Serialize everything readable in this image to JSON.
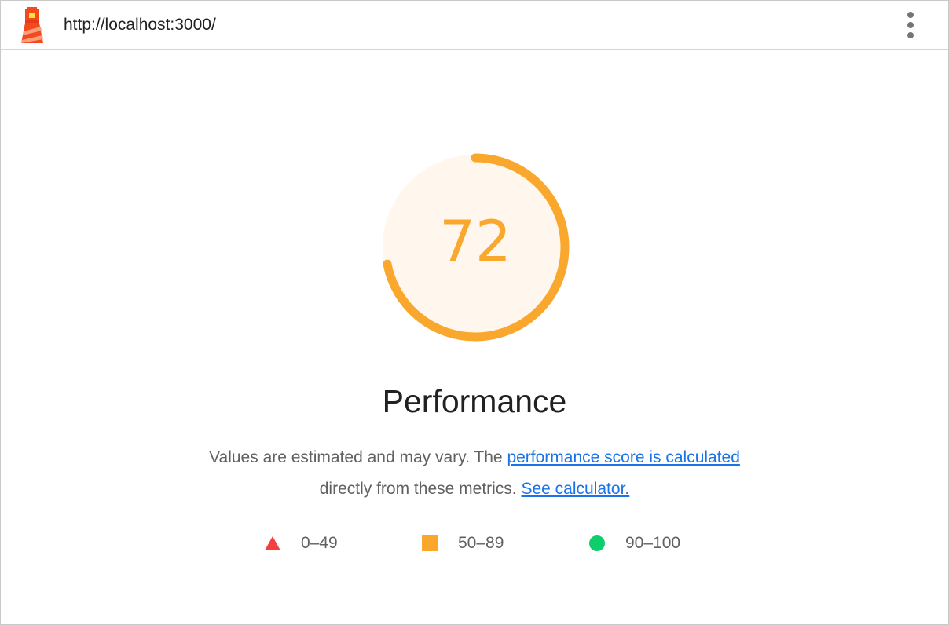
{
  "header": {
    "url": "http://localhost:3000/",
    "logo_icon": "lighthouse-icon",
    "menu_icon": "vertical-dots-icon"
  },
  "score": {
    "value": 72,
    "display": "72",
    "fraction": 0.72,
    "rating": "average",
    "color": "#f9a72d",
    "bg_color": "#fff7ee"
  },
  "category": {
    "title": "Performance"
  },
  "description": {
    "text_before": "Values are estimated and may vary. The ",
    "link_score": "performance score is calculated",
    "text_middle": " directly from these metrics. ",
    "link_calculator": "See calculator."
  },
  "legend": [
    {
      "range": "0–49",
      "shape": "triangle",
      "color": "#f33f3f"
    },
    {
      "range": "50–89",
      "shape": "square",
      "color": "#f9a72d"
    },
    {
      "range": "90–100",
      "shape": "circle",
      "color": "#0cce6b"
    }
  ],
  "colors": {
    "link": "#1a73e8",
    "text": "#212121",
    "muted": "#616161"
  }
}
